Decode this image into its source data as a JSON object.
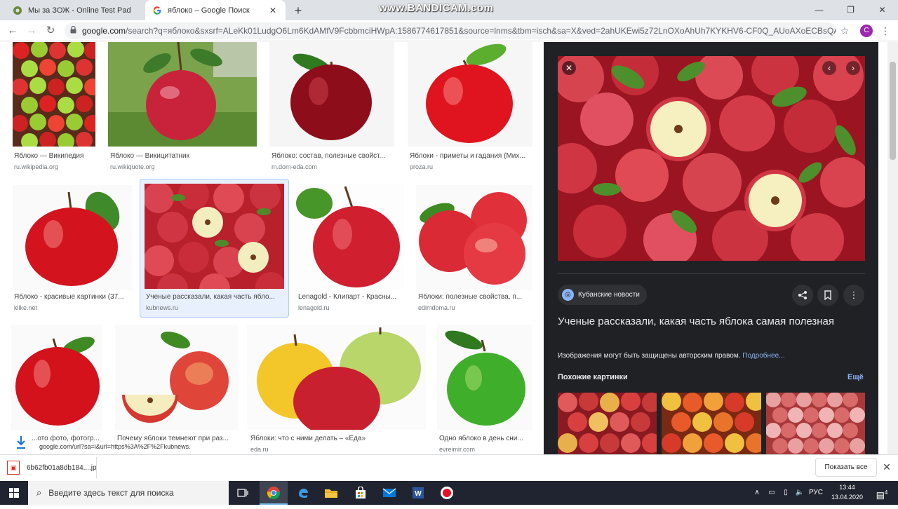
{
  "browser": {
    "tabs": [
      {
        "label": "Мы за ЗОЖ - Online Test Pad",
        "active": false
      },
      {
        "label": "яблоко – Google Поиск",
        "active": true
      }
    ],
    "new_tab": "+",
    "watermark": "www.BANDICAM.com",
    "window_controls": {
      "minimize": "—",
      "maximize": "❐",
      "close": "✕"
    },
    "nav": {
      "back": "←",
      "forward": "→",
      "reload": "↻"
    },
    "url_host": "google.com",
    "url_path": "/search?q=яблоко&sxsrf=ALeKk01LudgO6Lm6KdAMfV9FcbbmciHWpA:1586774617851&source=lnms&tbm=isch&sa=X&ved=2ahUKEwi5z72LnOXoAhUh7KYKHV6-CF0Q_AUoAXoECBsQAw&bi...",
    "profile_initial": "C"
  },
  "results": [
    {
      "caption": "Яблоко — Википедия",
      "domain": "ru.wikipedia.org"
    },
    {
      "caption": "Яблоко — Викицитатник",
      "domain": "ru.wikiquote.org"
    },
    {
      "caption": "Яблоко: состав, полезные свойст...",
      "domain": "m.dom-eda.com"
    },
    {
      "caption": "Яблоки - приметы и гадания (Мих...",
      "domain": "proza.ru"
    },
    {
      "caption": "Яблоко - красивые картинки (37...",
      "domain": "klike.net"
    },
    {
      "caption": "Ученые рассказали, какая часть ябло...",
      "domain": "kubnews.ru"
    },
    {
      "caption": "Lenagold - Клипарт - Красны...",
      "domain": "lenagold.ru"
    },
    {
      "caption": "Яблоки: полезные свойства, п...",
      "domain": "edimdoma.ru"
    },
    {
      "caption": "...ото фото, фотогр...",
      "domain": ""
    },
    {
      "caption": "Почему яблоки темнеют при раз...",
      "domain": ""
    },
    {
      "caption": "Яблоки: что с ними делать – «Еда»",
      "domain": "eda.ru"
    },
    {
      "caption": "Одно яблоко в день сни...",
      "domain": "evreimir.com"
    }
  ],
  "panel": {
    "source": "Кубанские новости",
    "title": "Ученые рассказали, какая часть яблока самая полезная",
    "copyright": "Изображения могут быть защищены авторским правом.",
    "more_link": "Подробнее...",
    "related_heading": "Похожие картинки",
    "related_more": "Ещё"
  },
  "status_url": "google.com/url?sa=i&url=https%3A%2F%2Fkubnews.",
  "downloads": {
    "file_name": "6b62fb01a8db184....jp",
    "show_all": "Показать все"
  },
  "taskbar": {
    "search_placeholder": "Введите здесь текст для поиска",
    "language": "РУС",
    "time": "13:44",
    "date": "13.04.2020",
    "notification_count": "4"
  },
  "colors": {
    "panel_bg": "#202124",
    "link_blue": "#8ab4f8",
    "selected_bg": "#e8f0fe"
  }
}
